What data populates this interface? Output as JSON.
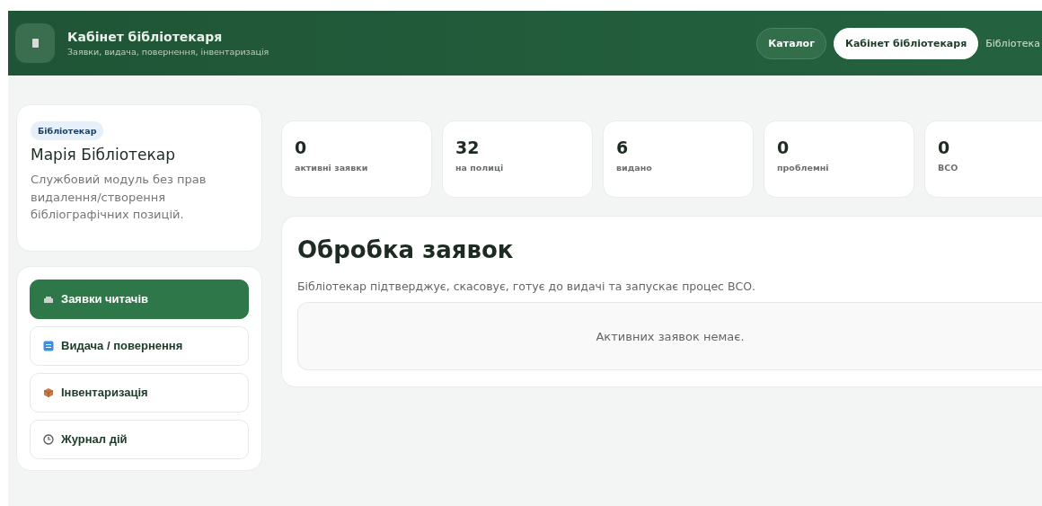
{
  "header": {
    "title": "Кабінет бібліотекаря",
    "subtitle": "Заявки, видача, повернення, інвентаризація",
    "nav": [
      {
        "label": "Каталог",
        "selected": false
      },
      {
        "label": "Кабінет бібліотекаря",
        "selected": true
      }
    ],
    "user": "Бібліотека"
  },
  "profile": {
    "role": "Бібліотекар",
    "name": "Марія Бібліотекар",
    "note": "Службовий модуль без прав видалення/створення бібліографічних позицій."
  },
  "menu": [
    {
      "label": "Заявки читачів",
      "kind": "tray",
      "selected": true
    },
    {
      "label": "Видача / повернення",
      "kind": "exchange",
      "selected": false
    },
    {
      "label": "Інвентаризація",
      "kind": "box",
      "selected": false
    },
    {
      "label": "Журнал дій",
      "kind": "clock",
      "selected": false
    }
  ],
  "stats": [
    {
      "value": "0",
      "label": "активні заявки"
    },
    {
      "value": "32",
      "label": "на полиці"
    },
    {
      "value": "6",
      "label": "видано"
    },
    {
      "value": "0",
      "label": "проблемні"
    },
    {
      "value": "0",
      "label": "ВСО"
    }
  ],
  "panel": {
    "title": "Обробка заявок",
    "description": "Бібліотекар підтверджує, скасовує, готує до видачі та запускає процес ВСО.",
    "empty": "Активних заявок немає."
  }
}
